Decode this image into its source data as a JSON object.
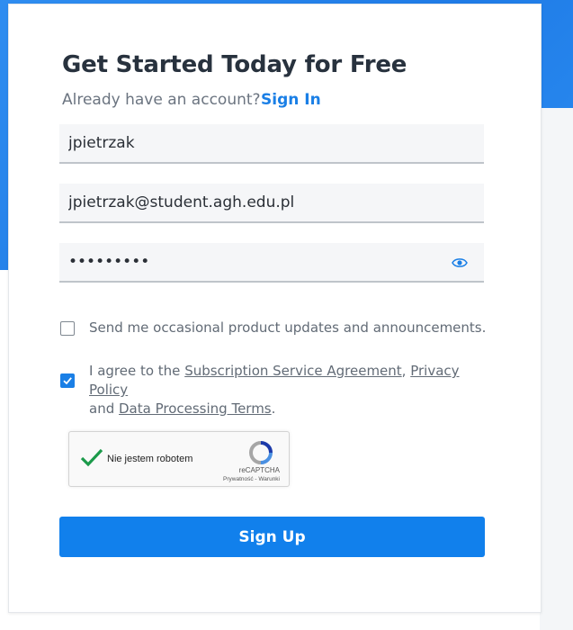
{
  "form": {
    "title": "Get Started Today for Free",
    "subtitle": "Already have an account?",
    "signin_link": "Sign In",
    "username_value": "jpietrzak",
    "email_value": "jpietrzak@student.agh.edu.pl",
    "password_value": "•••••••••",
    "password_icon": "eye-icon",
    "updates_checkbox": {
      "label": "Send me occasional product updates and announcements.",
      "checked": false
    },
    "terms_checkbox": {
      "checked": true,
      "text_prefix": "I agree to the ",
      "link_subscription": "Subscription Service Agreement",
      "comma": ", ",
      "link_privacy": "Privacy Policy",
      "text_and": "and ",
      "link_dpt": "Data Processing Terms",
      "period": "."
    },
    "recaptcha": {
      "label": "Nie jestem robotem",
      "brand": "reCAPTCHA",
      "links": "Prywatność - Warunki"
    },
    "submit_label": "Sign Up"
  },
  "colors": {
    "accent": "#1180ec",
    "link": "#1a7fe6",
    "background_blue": "#1f7be6"
  }
}
